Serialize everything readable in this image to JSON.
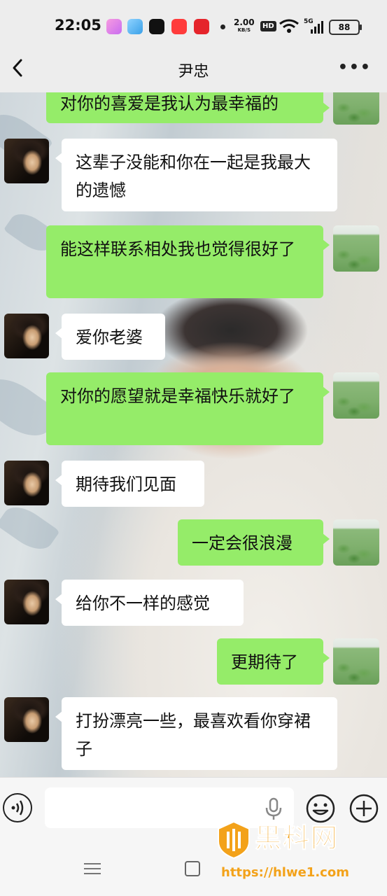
{
  "status_bar": {
    "time": "22:05",
    "network_speed": "2.00",
    "speed_unit": "KB/S",
    "hd_badge": "HD",
    "network": "5G",
    "battery": "88"
  },
  "header": {
    "title": "尹忠"
  },
  "messages": [
    {
      "side": "out",
      "text": "对你的喜爱是我认为最幸福的"
    },
    {
      "side": "in",
      "text": "这辈子没能和你在一起是我最大的遗憾"
    },
    {
      "side": "out",
      "text": "能这样联系相处我也觉得很好了"
    },
    {
      "side": "in",
      "text": "爱你老婆"
    },
    {
      "side": "out",
      "text": "对你的愿望就是幸福快乐就好了"
    },
    {
      "side": "in",
      "text": "期待我们见面"
    },
    {
      "side": "out",
      "text": "一定会很浪漫"
    },
    {
      "side": "in",
      "text": "给你不一样的感觉"
    },
    {
      "side": "out",
      "text": "更期待了"
    },
    {
      "side": "in",
      "text": "打扮漂亮一些，最喜欢看你穿裙子"
    }
  ],
  "watermark": {
    "name": "黑料网",
    "url": "https://hlwe1.com"
  },
  "colors": {
    "outgoing_bubble": "#95ec69",
    "incoming_bubble": "#ffffff",
    "watermark": "#f3a21a"
  }
}
